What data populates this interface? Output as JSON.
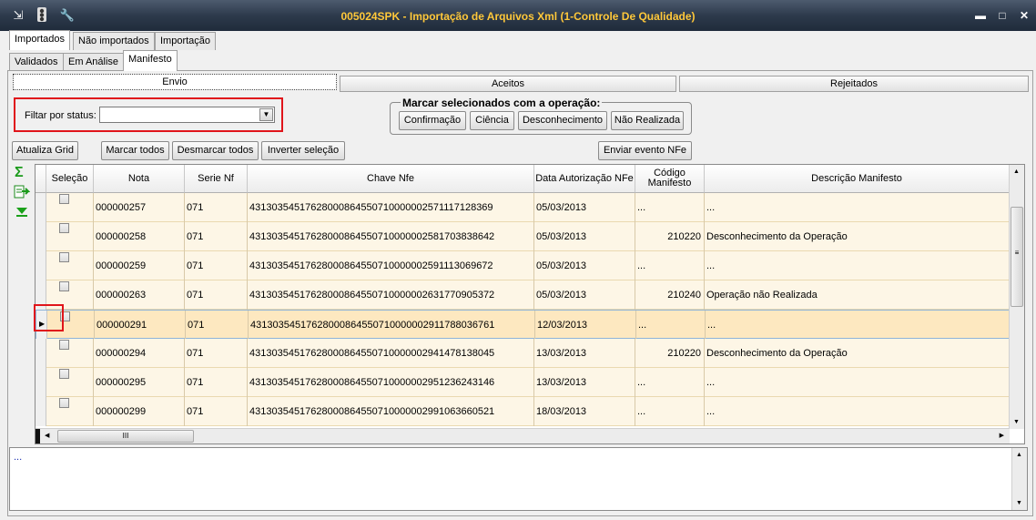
{
  "window": {
    "title": "005024SPK - Importação de Arquivos Xml (1-Controle De Qualidade)",
    "left_icons": [
      "export-icon",
      "traffic-light-icon",
      "wrench-icon"
    ],
    "controls": {
      "minimize": "▬",
      "maximize": "□",
      "close": "✕"
    }
  },
  "main_tabs": [
    "Importados",
    "Não importados",
    "Importação"
  ],
  "sub_tabs": [
    "Validados",
    "Em Análise",
    "Manifesto"
  ],
  "manifesto_tabs": [
    "Envio",
    "Aceitos",
    "Rejeitados"
  ],
  "filter": {
    "label": "Filtar por status:",
    "value": ""
  },
  "operation_group": {
    "title": "Marcar selecionados com a operação:",
    "buttons": [
      "Confirmação",
      "Ciência",
      "Desconhecimento",
      "Não Realizada"
    ]
  },
  "toolbar": {
    "refresh": "Atualiza Grid",
    "mark_all": "Marcar todos",
    "unmark_all": "Desmarcar todos",
    "invert": "Inverter seleção",
    "send": "Enviar evento NFe"
  },
  "side_icons": [
    "sigma-icon",
    "export-green-icon",
    "collapse-down-icon"
  ],
  "grid": {
    "columns": [
      "Seleção",
      "Nota",
      "Serie Nf",
      "Chave Nfe",
      "Data Autorização NFe",
      "Código Manifesto",
      "Descrição Manifesto"
    ],
    "rows": [
      {
        "nota": "000000257",
        "serie": "071",
        "chave": "43130354517628000864550710000002571117128369",
        "data": "05/03/2013",
        "codigo": "...",
        "descricao": "..."
      },
      {
        "nota": "000000258",
        "serie": "071",
        "chave": "43130354517628000864550710000002581703838642",
        "data": "05/03/2013",
        "codigo": "210220",
        "descricao": "Desconhecimento da Operação"
      },
      {
        "nota": "000000259",
        "serie": "071",
        "chave": "43130354517628000864550710000002591113069672",
        "data": "05/03/2013",
        "codigo": "...",
        "descricao": "..."
      },
      {
        "nota": "000000263",
        "serie": "071",
        "chave": "43130354517628000864550710000002631770905372",
        "data": "05/03/2013",
        "codigo": "210240",
        "descricao": "Operação não Realizada"
      },
      {
        "nota": "000000291",
        "serie": "071",
        "chave": "43130354517628000864550710000002911788036761",
        "data": "12/03/2013",
        "codigo": "...",
        "descricao": "..."
      },
      {
        "nota": "000000294",
        "serie": "071",
        "chave": "43130354517628000864550710000002941478138045",
        "data": "13/03/2013",
        "codigo": "210220",
        "descricao": "Desconhecimento da Operação"
      },
      {
        "nota": "000000295",
        "serie": "071",
        "chave": "43130354517628000864550710000002951236243146",
        "data": "13/03/2013",
        "codigo": "...",
        "descricao": "..."
      },
      {
        "nota": "000000299",
        "serie": "071",
        "chave": "43130354517628000864550710000002991063660521",
        "data": "18/03/2013",
        "codigo": "...",
        "descricao": "..."
      }
    ],
    "selected_row_index": 4,
    "hscroll_grip": "III"
  },
  "log": {
    "text": "..."
  }
}
